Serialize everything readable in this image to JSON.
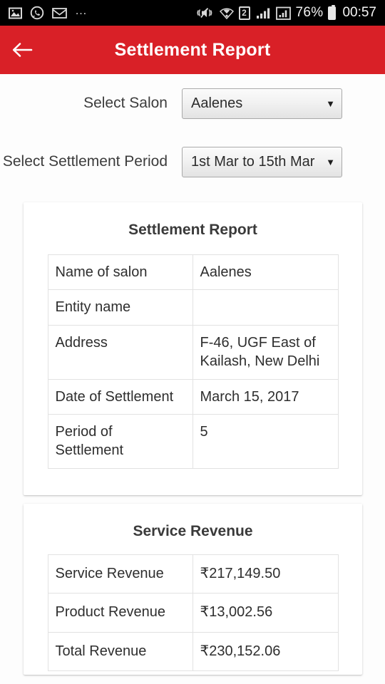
{
  "status_bar": {
    "left_icons": [
      "image-icon",
      "whatsapp-icon",
      "mail-icon",
      "overflow-dots-icon"
    ],
    "right_icons": [
      "vibrate-mute-icon",
      "wifi-icon",
      "sim2-icon",
      "signal-icon",
      "signal-alt-icon"
    ],
    "sim_label": "2",
    "battery_percent": "76%",
    "clock": "00:57"
  },
  "appbar": {
    "back_icon": "arrow-left-icon",
    "title": "Settlement Report",
    "background_color": "#d92027"
  },
  "selectors": [
    {
      "label": "Select Salon",
      "name": "salon",
      "value": "Aalenes",
      "arrow": "▼"
    },
    {
      "label": "Select Settlement Period",
      "name": "settlement-period",
      "value": "1st Mar to 15th Mar",
      "arrow": "▼"
    }
  ],
  "cards": [
    {
      "title": "Settlement Report",
      "rows": [
        {
          "key": "Name of salon",
          "value": "Aalenes"
        },
        {
          "key": "Entity name",
          "value": ""
        },
        {
          "key": "Address",
          "value": "F-46, UGF East of Kailash, New Delhi"
        },
        {
          "key": "Date of Settlement",
          "value": "March 15, 2017"
        },
        {
          "key": "Period of Settlement",
          "value": "5"
        }
      ]
    },
    {
      "title": "Service Revenue",
      "rows": [
        {
          "key": "Service Revenue",
          "value": "₹217,149.50"
        },
        {
          "key": "Product Revenue",
          "value": "₹13,002.56"
        },
        {
          "key": "Total Revenue",
          "value": "₹230,152.06"
        }
      ]
    }
  ]
}
